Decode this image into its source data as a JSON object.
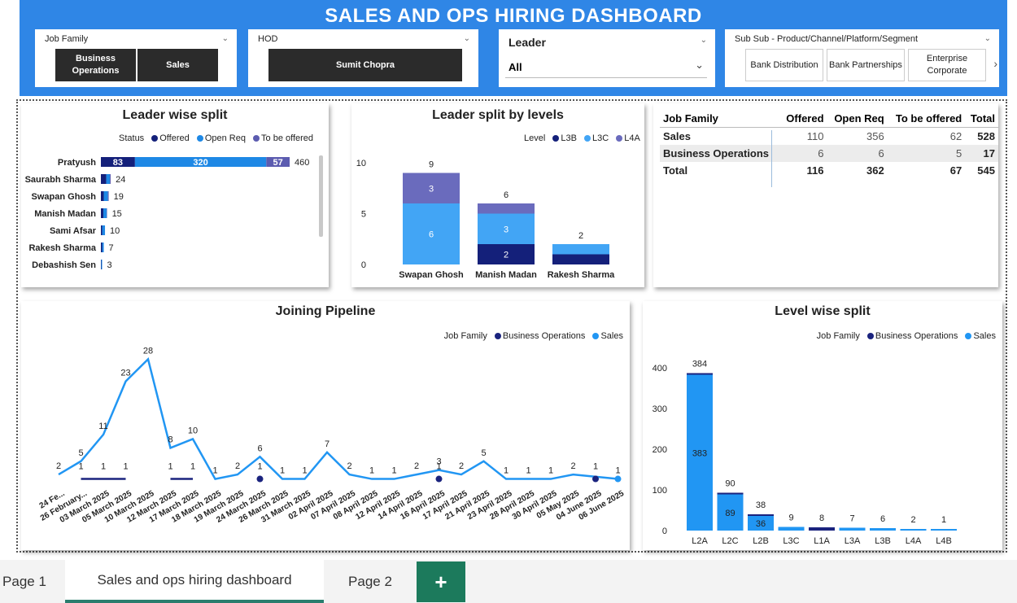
{
  "header": {
    "title": "SALES AND OPS HIRING DASHBOARD"
  },
  "slicers": {
    "job_family": {
      "label": "Job Family",
      "chips": [
        "Business Operations",
        "Sales"
      ]
    },
    "hod": {
      "label": "HOD",
      "chips": [
        "Sumit Chopra"
      ]
    },
    "leader": {
      "label": "Leader",
      "value": "All"
    },
    "segment": {
      "label": "Sub Sub - Product/Channel/Platform/Segment",
      "chips": [
        "Bank Distribution",
        "Bank Partnerships",
        "Enterprise Corporate"
      ]
    }
  },
  "leader_split": {
    "title": "Leader wise split",
    "legend_label": "Status",
    "legend": [
      "Offered",
      "Open Req",
      "To be offered"
    ]
  },
  "levels_split": {
    "title": "Leader split by levels",
    "legend_label": "Level",
    "legend": [
      "L3B",
      "L3C",
      "L4A"
    ]
  },
  "matrix": {
    "headers": [
      "Job Family",
      "Offered",
      "Open Req",
      "To be offered",
      "Total"
    ],
    "rows": [
      [
        "Sales",
        "110",
        "356",
        "62",
        "528"
      ],
      [
        "Business Operations",
        "6",
        "6",
        "5",
        "17"
      ]
    ],
    "total": [
      "Total",
      "116",
      "362",
      "67",
      "545"
    ]
  },
  "pipeline": {
    "title": "Joining Pipeline",
    "legend_label": "Job Family",
    "legend": [
      "Business Operations",
      "Sales"
    ]
  },
  "level_wise": {
    "title": "Level wise split",
    "legend_label": "Job Family",
    "legend": [
      "Business Operations",
      "Sales"
    ]
  },
  "tabs": [
    "Page 1",
    "Sales and ops hiring dashboard",
    "Page 2"
  ],
  "add_tab": "+",
  "colors": {
    "dark": "#14207a",
    "mid": "#1e88e5",
    "light": "#6a6bbd",
    "header": "#2f86e6",
    "sales": "#2196f3",
    "ops": "#1a237e"
  },
  "chart_data": [
    {
      "type": "bar",
      "orientation": "horizontal",
      "title": "Leader wise split",
      "categories": [
        "Pratyush",
        "Saurabh Sharma",
        "Swapan Ghosh",
        "Manish Madan",
        "Sami Afsar",
        "Rakesh Sharma",
        "Debashish Sen"
      ],
      "series": [
        {
          "name": "Offered",
          "values": [
            83,
            13,
            7,
            6,
            3,
            3,
            1
          ]
        },
        {
          "name": "Open Req",
          "values": [
            320,
            9,
            10,
            8,
            7,
            4,
            2
          ]
        },
        {
          "name": "To be offered",
          "values": [
            57,
            2,
            2,
            1,
            0,
            0,
            0
          ]
        }
      ],
      "totals": [
        460,
        24,
        19,
        15,
        10,
        7,
        3
      ],
      "stacked": true
    },
    {
      "type": "bar",
      "title": "Leader split by levels",
      "categories": [
        "Swapan Ghosh",
        "Manish Madan",
        "Rakesh Sharma"
      ],
      "series": [
        {
          "name": "L3B",
          "values": [
            0,
            2,
            1
          ]
        },
        {
          "name": "L3C",
          "values": [
            6,
            3,
            1
          ]
        },
        {
          "name": "L4A",
          "values": [
            3,
            1,
            0
          ]
        }
      ],
      "totals": [
        9,
        6,
        2
      ],
      "yticks": [
        0,
        5,
        10
      ],
      "ylim": [
        0,
        10
      ],
      "stacked": true
    },
    {
      "type": "line",
      "title": "Joining Pipeline",
      "x": [
        "24 Fe...",
        "26 February...",
        "03 March 2025",
        "05 March 2025",
        "10 March 2025",
        "12 March 2025",
        "17 March 2025",
        "18 March 2025",
        "19 March 2025",
        "24 March 2025",
        "26 March 2025",
        "31 March 2025",
        "02 April 2025",
        "07 April 2025",
        "08 April 2025",
        "12 April 2025",
        "14 April 2025",
        "16 April 2025",
        "17 April 2025",
        "21 April 2025",
        "23 April 2025",
        "28 April 2025",
        "30 April 2025",
        "05 May 2025",
        "04 June 2025",
        "06 June 2025"
      ],
      "series": [
        {
          "name": "Sales",
          "values": [
            2,
            5,
            11,
            23,
            28,
            8,
            10,
            1,
            2,
            6,
            1,
            1,
            7,
            2,
            1,
            1,
            2,
            3,
            2,
            5,
            1,
            1,
            1,
            2,
            null,
            1
          ]
        },
        {
          "name": "Business Operations",
          "values": [
            null,
            1,
            1,
            1,
            null,
            1,
            1,
            null,
            null,
            1,
            null,
            null,
            null,
            null,
            null,
            null,
            null,
            1,
            null,
            null,
            null,
            null,
            null,
            null,
            1,
            null
          ]
        }
      ]
    },
    {
      "type": "bar",
      "title": "Level wise split",
      "categories": [
        "L2A",
        "L2C",
        "L2B",
        "L3C",
        "L1A",
        "L3A",
        "L3B",
        "L4A",
        "L4B"
      ],
      "series": [
        {
          "name": "Business Operations",
          "values": [
            1,
            1,
            2,
            0,
            8,
            0,
            0,
            0,
            0
          ]
        },
        {
          "name": "Sales",
          "values": [
            383,
            89,
            36,
            9,
            0,
            7,
            6,
            2,
            1
          ]
        }
      ],
      "totals": [
        384,
        90,
        38,
        9,
        8,
        7,
        6,
        2,
        1
      ],
      "yticks": [
        0,
        100,
        200,
        300,
        400
      ],
      "ylim": [
        0,
        420
      ],
      "stacked": true
    }
  ]
}
